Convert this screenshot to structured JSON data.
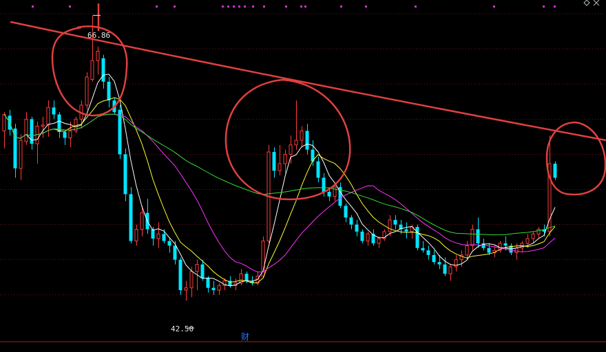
{
  "chart_data": {
    "type": "candlestick",
    "title": "",
    "xlabel": "",
    "ylabel": "",
    "ylim": [
      40,
      67
    ],
    "colors": {
      "background": "#000000",
      "up": "#ff3d3d",
      "down": "#00e5ff",
      "grid": "#7a1515",
      "ma5": "#ffffff",
      "ma10": "#ffff33",
      "ma20": "#ff33ff",
      "ma60": "#33dd33",
      "annotation": "#e04040",
      "top_markers": "#cc33cc",
      "fin_marker": "#2f6fff"
    },
    "annotations": {
      "high_label": "66.86",
      "low_label": "42.50",
      "fin_marker": "财"
    },
    "candles": [
      {
        "o": 57.0,
        "h": 58.6,
        "l": 55.5,
        "c": 58.4
      },
      {
        "o": 58.3,
        "h": 58.8,
        "l": 56.6,
        "c": 57.1
      },
      {
        "o": 57.2,
        "h": 57.6,
        "l": 53.0,
        "c": 53.8
      },
      {
        "o": 53.8,
        "h": 56.7,
        "l": 52.8,
        "c": 56.2
      },
      {
        "o": 56.1,
        "h": 58.6,
        "l": 55.8,
        "c": 58.0
      },
      {
        "o": 58.0,
        "h": 58.2,
        "l": 55.4,
        "c": 55.9
      },
      {
        "o": 55.9,
        "h": 57.8,
        "l": 54.2,
        "c": 57.4
      },
      {
        "o": 57.4,
        "h": 58.2,
        "l": 56.4,
        "c": 57.5
      },
      {
        "o": 57.5,
        "h": 59.6,
        "l": 56.5,
        "c": 59.0
      },
      {
        "o": 59.0,
        "h": 59.6,
        "l": 58.0,
        "c": 58.4
      },
      {
        "o": 58.4,
        "h": 58.6,
        "l": 56.4,
        "c": 56.9
      },
      {
        "o": 56.9,
        "h": 57.0,
        "l": 55.8,
        "c": 56.4
      },
      {
        "o": 56.4,
        "h": 57.8,
        "l": 55.6,
        "c": 57.0
      },
      {
        "o": 57.0,
        "h": 58.2,
        "l": 56.8,
        "c": 58.0
      },
      {
        "o": 58.0,
        "h": 59.6,
        "l": 57.2,
        "c": 59.2
      },
      {
        "o": 59.2,
        "h": 62.0,
        "l": 58.8,
        "c": 61.6
      },
      {
        "o": 61.4,
        "h": 66.86,
        "l": 61.2,
        "c": 63.0
      },
      {
        "o": 63.0,
        "h": 64.2,
        "l": 61.8,
        "c": 63.8
      },
      {
        "o": 63.2,
        "h": 63.5,
        "l": 60.6,
        "c": 61.2
      },
      {
        "o": 61.2,
        "h": 61.6,
        "l": 59.0,
        "c": 59.6
      },
      {
        "o": 59.6,
        "h": 59.8,
        "l": 58.4,
        "c": 58.6
      },
      {
        "o": 58.8,
        "h": 59.2,
        "l": 54.6,
        "c": 55.0
      },
      {
        "o": 55.0,
        "h": 55.5,
        "l": 51.0,
        "c": 51.6
      },
      {
        "o": 51.6,
        "h": 52.2,
        "l": 47.4,
        "c": 47.6
      },
      {
        "o": 47.6,
        "h": 49.0,
        "l": 47.2,
        "c": 48.6
      },
      {
        "o": 48.6,
        "h": 50.6,
        "l": 48.0,
        "c": 50.0
      },
      {
        "o": 50.0,
        "h": 51.2,
        "l": 48.2,
        "c": 48.6
      },
      {
        "o": 48.6,
        "h": 48.8,
        "l": 47.2,
        "c": 47.8
      },
      {
        "o": 47.8,
        "h": 49.2,
        "l": 47.0,
        "c": 48.2
      },
      {
        "o": 48.2,
        "h": 48.6,
        "l": 47.4,
        "c": 47.6
      },
      {
        "o": 47.6,
        "h": 47.9,
        "l": 46.6,
        "c": 47.2
      },
      {
        "o": 47.2,
        "h": 47.6,
        "l": 45.6,
        "c": 46.0
      },
      {
        "o": 46.0,
        "h": 46.2,
        "l": 43.0,
        "c": 43.4
      },
      {
        "o": 43.4,
        "h": 44.2,
        "l": 42.5,
        "c": 43.6
      },
      {
        "o": 43.6,
        "h": 45.4,
        "l": 42.8,
        "c": 45.0
      },
      {
        "o": 45.0,
        "h": 46.0,
        "l": 43.4,
        "c": 45.6
      },
      {
        "o": 45.6,
        "h": 46.0,
        "l": 44.2,
        "c": 44.4
      },
      {
        "o": 44.4,
        "h": 44.6,
        "l": 43.2,
        "c": 43.6
      },
      {
        "o": 43.6,
        "h": 44.2,
        "l": 43.0,
        "c": 43.4
      },
      {
        "o": 43.4,
        "h": 44.0,
        "l": 43.0,
        "c": 43.8
      },
      {
        "o": 43.8,
        "h": 44.4,
        "l": 43.4,
        "c": 44.2
      },
      {
        "o": 44.2,
        "h": 44.6,
        "l": 43.6,
        "c": 43.8
      },
      {
        "o": 43.8,
        "h": 44.4,
        "l": 43.4,
        "c": 44.0
      },
      {
        "o": 44.0,
        "h": 45.2,
        "l": 43.8,
        "c": 44.8
      },
      {
        "o": 44.8,
        "h": 45.0,
        "l": 44.0,
        "c": 44.2
      },
      {
        "o": 44.2,
        "h": 44.6,
        "l": 43.8,
        "c": 44.0
      },
      {
        "o": 44.0,
        "h": 45.0,
        "l": 43.8,
        "c": 44.6
      },
      {
        "o": 44.6,
        "h": 48.0,
        "l": 44.4,
        "c": 47.6
      },
      {
        "o": 47.6,
        "h": 55.8,
        "l": 47.4,
        "c": 55.2
      },
      {
        "o": 55.2,
        "h": 55.6,
        "l": 53.0,
        "c": 53.6
      },
      {
        "o": 53.6,
        "h": 55.8,
        "l": 53.2,
        "c": 54.2
      },
      {
        "o": 54.2,
        "h": 55.4,
        "l": 53.4,
        "c": 55.0
      },
      {
        "o": 55.0,
        "h": 56.6,
        "l": 54.2,
        "c": 55.8
      },
      {
        "o": 55.8,
        "h": 59.6,
        "l": 55.4,
        "c": 56.2
      },
      {
        "o": 56.2,
        "h": 57.4,
        "l": 55.6,
        "c": 57.0
      },
      {
        "o": 57.0,
        "h": 57.6,
        "l": 55.0,
        "c": 55.4
      },
      {
        "o": 55.4,
        "h": 56.2,
        "l": 54.0,
        "c": 54.4
      },
      {
        "o": 54.4,
        "h": 54.8,
        "l": 52.6,
        "c": 53.0
      },
      {
        "o": 53.0,
        "h": 53.4,
        "l": 51.4,
        "c": 51.8
      },
      {
        "o": 51.8,
        "h": 52.2,
        "l": 51.0,
        "c": 51.4
      },
      {
        "o": 51.4,
        "h": 52.6,
        "l": 51.0,
        "c": 52.2
      },
      {
        "o": 52.2,
        "h": 52.6,
        "l": 50.4,
        "c": 50.6
      },
      {
        "o": 50.6,
        "h": 50.8,
        "l": 49.2,
        "c": 49.6
      },
      {
        "o": 49.6,
        "h": 49.8,
        "l": 48.6,
        "c": 49.0
      },
      {
        "o": 49.0,
        "h": 49.4,
        "l": 48.0,
        "c": 48.4
      },
      {
        "o": 48.4,
        "h": 48.6,
        "l": 47.4,
        "c": 47.6
      },
      {
        "o": 47.6,
        "h": 48.4,
        "l": 47.2,
        "c": 48.2
      },
      {
        "o": 48.2,
        "h": 48.6,
        "l": 47.2,
        "c": 47.4
      },
      {
        "o": 47.4,
        "h": 48.0,
        "l": 47.0,
        "c": 47.8
      },
      {
        "o": 47.8,
        "h": 48.6,
        "l": 47.6,
        "c": 48.4
      },
      {
        "o": 48.4,
        "h": 49.8,
        "l": 48.0,
        "c": 49.4
      },
      {
        "o": 49.4,
        "h": 49.8,
        "l": 48.6,
        "c": 49.0
      },
      {
        "o": 49.0,
        "h": 49.4,
        "l": 48.2,
        "c": 48.6
      },
      {
        "o": 48.6,
        "h": 49.2,
        "l": 47.8,
        "c": 48.4
      },
      {
        "o": 48.4,
        "h": 49.0,
        "l": 47.8,
        "c": 48.8
      },
      {
        "o": 48.8,
        "h": 49.0,
        "l": 46.8,
        "c": 47.0
      },
      {
        "o": 47.0,
        "h": 47.6,
        "l": 46.6,
        "c": 46.8
      },
      {
        "o": 46.8,
        "h": 47.2,
        "l": 46.0,
        "c": 46.4
      },
      {
        "o": 46.4,
        "h": 46.8,
        "l": 45.6,
        "c": 45.8
      },
      {
        "o": 45.8,
        "h": 46.4,
        "l": 45.2,
        "c": 45.6
      },
      {
        "o": 45.6,
        "h": 46.2,
        "l": 44.6,
        "c": 44.8
      },
      {
        "o": 44.8,
        "h": 45.6,
        "l": 44.2,
        "c": 45.4
      },
      {
        "o": 45.4,
        "h": 46.4,
        "l": 45.0,
        "c": 46.0
      },
      {
        "o": 46.0,
        "h": 46.8,
        "l": 45.4,
        "c": 46.4
      },
      {
        "o": 46.4,
        "h": 47.6,
        "l": 46.0,
        "c": 47.2
      },
      {
        "o": 47.2,
        "h": 49.0,
        "l": 46.8,
        "c": 48.6
      },
      {
        "o": 48.6,
        "h": 49.6,
        "l": 47.0,
        "c": 47.4
      },
      {
        "o": 47.4,
        "h": 47.8,
        "l": 46.8,
        "c": 47.0
      },
      {
        "o": 47.0,
        "h": 47.4,
        "l": 46.4,
        "c": 46.6
      },
      {
        "o": 46.6,
        "h": 47.2,
        "l": 46.2,
        "c": 46.8
      },
      {
        "o": 46.8,
        "h": 47.6,
        "l": 46.6,
        "c": 47.4
      },
      {
        "o": 47.4,
        "h": 48.0,
        "l": 46.8,
        "c": 47.2
      },
      {
        "o": 47.2,
        "h": 47.4,
        "l": 46.4,
        "c": 46.6
      },
      {
        "o": 46.6,
        "h": 47.4,
        "l": 46.0,
        "c": 47.0
      },
      {
        "o": 47.0,
        "h": 47.6,
        "l": 46.6,
        "c": 47.4
      },
      {
        "o": 47.4,
        "h": 48.2,
        "l": 47.0,
        "c": 47.8
      },
      {
        "o": 47.8,
        "h": 48.4,
        "l": 47.4,
        "c": 48.2
      },
      {
        "o": 48.2,
        "h": 48.8,
        "l": 47.8,
        "c": 48.6
      },
      {
        "o": 48.6,
        "h": 49.0,
        "l": 48.0,
        "c": 48.4
      },
      {
        "o": 48.4,
        "h": 56.6,
        "l": 48.0,
        "c": 54.2
      },
      {
        "o": 54.2,
        "h": 54.4,
        "l": 52.8,
        "c": 53.0
      }
    ]
  }
}
